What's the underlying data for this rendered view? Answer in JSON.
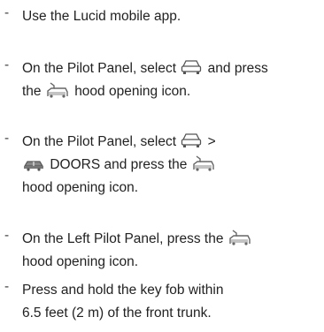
{
  "items": [
    {
      "dash": "-",
      "text": "Use the Lucid mobile app."
    },
    {
      "dash": "-",
      "part1": "On the Pilot Panel, select",
      "part2": "and press the",
      "part3": "hood opening icon."
    },
    {
      "dash": "-",
      "part1": "On the Pilot Panel, select",
      "part2": ">",
      "part3": "DOORS and press the",
      "part4": "hood opening icon."
    },
    {
      "dash": "-",
      "part1": "On the Left Pilot Panel, press the",
      "part2": "hood opening icon."
    },
    {
      "dash": "-",
      "line1": "Press and hold the key fob within",
      "line2": "6.5 feet (2 m) of the front trunk."
    }
  ],
  "icons": {
    "vehicle": "car-front-icon",
    "hood": "hood-opening-icon",
    "doors": "car-doors-icon"
  }
}
